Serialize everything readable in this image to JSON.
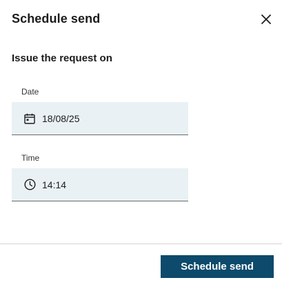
{
  "dialog": {
    "title": "Schedule send",
    "close_icon": "close-icon"
  },
  "form": {
    "heading": "Issue the request on",
    "date": {
      "label": "Date",
      "value": "18/08/25",
      "icon": "calendar-icon"
    },
    "time": {
      "label": "Time",
      "value": "14:14",
      "icon": "clock-icon"
    }
  },
  "footer": {
    "submit_label": "Schedule send"
  },
  "colors": {
    "field_background": "#e9f1f4",
    "primary_button": "#0d4a6b",
    "text": "#1c1c1c",
    "divider": "#d4d4d4"
  }
}
